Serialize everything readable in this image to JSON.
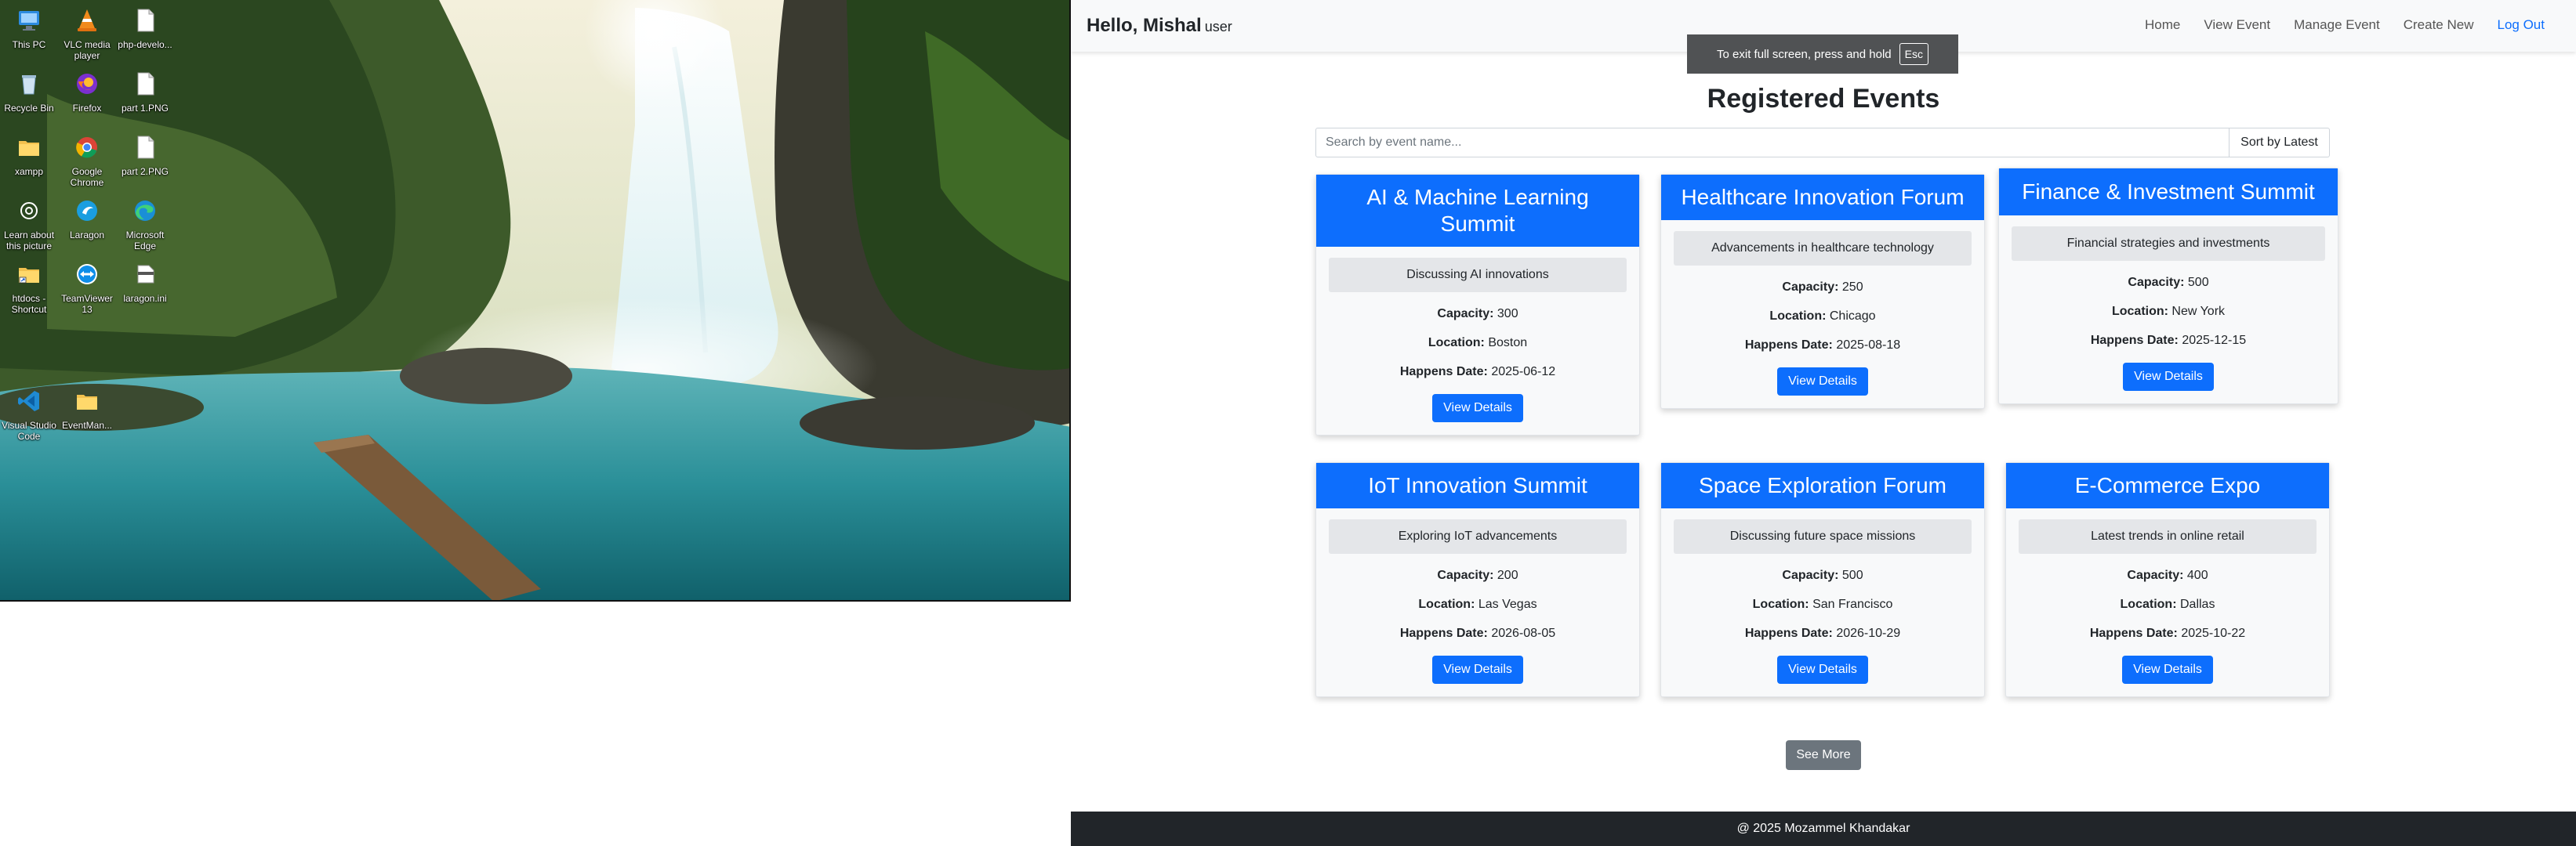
{
  "desktop": {
    "icons": [
      {
        "label": "This PC",
        "icon": "computer-icon"
      },
      {
        "label": "VLC media player",
        "icon": "vlc-cone-icon"
      },
      {
        "label": "php-develo...",
        "icon": "document-icon"
      },
      {
        "label": "Recycle Bin",
        "icon": "recycle-bin-icon"
      },
      {
        "label": "Firefox",
        "icon": "firefox-icon"
      },
      {
        "label": "part 1.PNG",
        "icon": "image-file-icon"
      },
      {
        "label": "xampp",
        "icon": "folder-icon"
      },
      {
        "label": "Google Chrome",
        "icon": "chrome-icon"
      },
      {
        "label": "part 2.PNG",
        "icon": "image-file-icon"
      },
      {
        "label": "Learn about this picture",
        "icon": "camera-icon"
      },
      {
        "label": "Laragon",
        "icon": "laragon-icon"
      },
      {
        "label": "Microsoft Edge",
        "icon": "edge-icon"
      },
      {
        "label": "htdocs - Shortcut",
        "icon": "folder-shortcut-icon"
      },
      {
        "label": "TeamViewer 13",
        "icon": "teamviewer-icon"
      },
      {
        "label": "laragon.ini",
        "icon": "ini-file-icon"
      },
      {
        "label": "Visual Studio Code",
        "icon": "vscode-icon"
      },
      {
        "label": "EventMan...",
        "icon": "folder-icon"
      }
    ]
  },
  "nav": {
    "greeting": "Hello, Mishal",
    "role": "user",
    "links": [
      "Home",
      "View Event",
      "Manage Event",
      "Create New",
      "Log Out"
    ]
  },
  "fullscreen_toast": {
    "text": "To exit full screen, press and hold",
    "key": "Esc"
  },
  "heading": "Registered Events",
  "search": {
    "placeholder": "Search by event name...",
    "value": ""
  },
  "sort_label": "Sort by Latest",
  "labels": {
    "capacity": "Capacity:",
    "location": "Location:",
    "date": "Happens Date:",
    "button": "View Details"
  },
  "events": [
    {
      "title": "AI & Machine Learning Summit",
      "description": "Discussing AI innovations",
      "capacity": "300",
      "location": "Boston",
      "date": "2025-06-12"
    },
    {
      "title": "Healthcare Innovation Forum",
      "description": "Advancements in healthcare technology",
      "capacity": "250",
      "location": "Chicago",
      "date": "2025-08-18"
    },
    {
      "title": "Finance & Investment Summit",
      "description": "Financial strategies and investments",
      "capacity": "500",
      "location": "New York",
      "date": "2025-12-15"
    },
    {
      "title": "IoT Innovation Summit",
      "description": "Exploring IoT advancements",
      "capacity": "200",
      "location": "Las Vegas",
      "date": "2026-08-05"
    },
    {
      "title": "Space Exploration Forum",
      "description": "Discussing future space missions",
      "capacity": "500",
      "location": "San Francisco",
      "date": "2026-10-29"
    },
    {
      "title": "E-Commerce Expo",
      "description": "Latest trends in online retail",
      "capacity": "400",
      "location": "Dallas",
      "date": "2025-10-22"
    }
  ],
  "see_more": "See More",
  "footer": "@ 2025 Mozammel Khandakar",
  "colors": {
    "primary": "#0d6efd",
    "secondary": "#6c757d",
    "footer": "#212529",
    "navbar": "#f8f9fa"
  }
}
